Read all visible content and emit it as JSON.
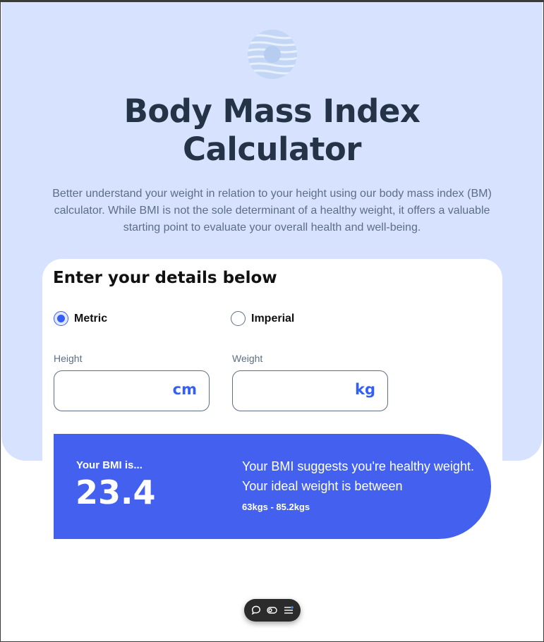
{
  "hero": {
    "title_line1": "Body Mass Index",
    "title_line2": "Calculator",
    "intro": "Better understand your weight in relation to your height using our body mass index (BM) calculator. While BMI is not the sole determinant of a healthy weight, it offers a valuable starting point to evaluate your overall health and well-being.",
    "logo_icon": "logo-icon"
  },
  "form": {
    "title": "Enter your details below",
    "units": [
      {
        "label": "Metric",
        "checked": true
      },
      {
        "label": "Imperial",
        "checked": false
      }
    ],
    "height": {
      "label": "Height",
      "value": "",
      "unit": "cm"
    },
    "weight": {
      "label": "Weight",
      "value": "",
      "unit": "kg"
    }
  },
  "result": {
    "label": "Your BMI is...",
    "value": "23.4",
    "message": "Your BMI suggests you're healthy weight. Your ideal weight is between",
    "range": "63kgs - 85.2kgs"
  },
  "toolbar": {
    "icons": [
      "comment-icon",
      "toggle-icon",
      "settings-list-icon"
    ]
  },
  "colors": {
    "hero_bg": "#d6e2fe",
    "accent": "#345ff6",
    "result_bg": "#4361ee",
    "heading": "#253347",
    "muted": "#5e6e85"
  }
}
